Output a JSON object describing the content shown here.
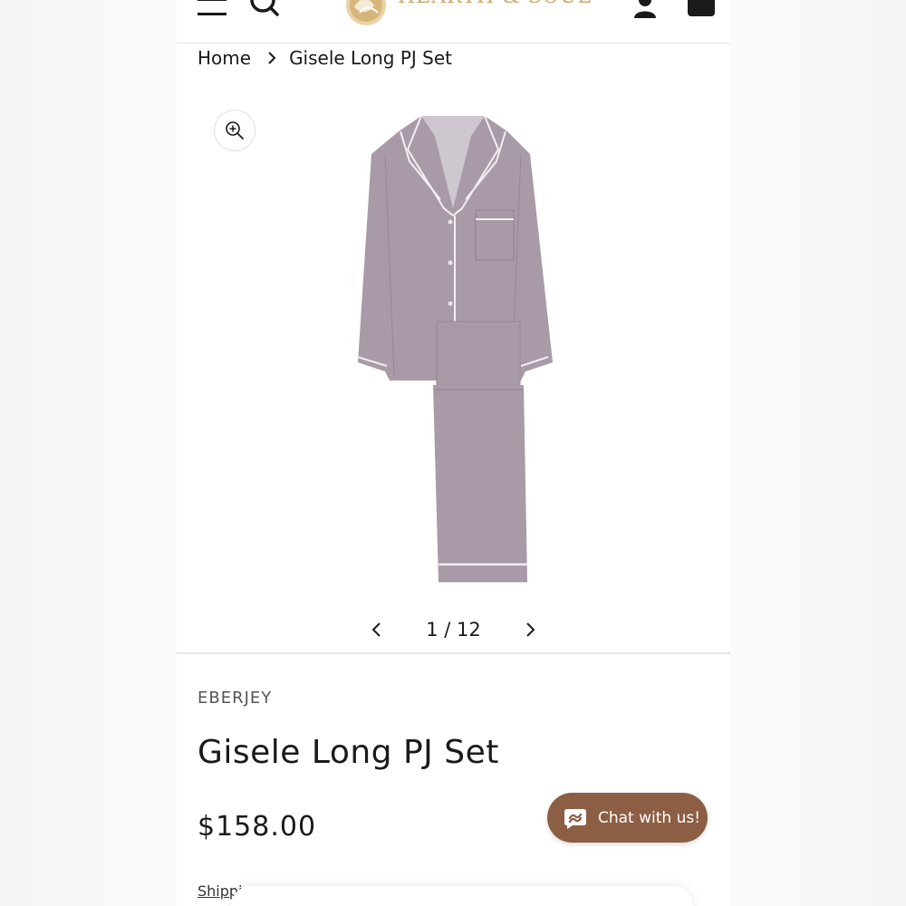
{
  "header": {
    "logo_text": "HEARTH & SOUL",
    "menu_icon": "hamburger-menu-icon",
    "search_icon": "search-icon",
    "account_icon": "account-icon",
    "cart_icon": "cart-icon",
    "logo_color": "#c9a86a"
  },
  "breadcrumb": {
    "home": "Home",
    "current": "Gisele Long PJ Set"
  },
  "gallery": {
    "zoom_icon": "zoom-in-icon",
    "counter": "1 / 12",
    "prev_icon": "chevron-left-icon",
    "next_icon": "chevron-right-icon",
    "product_color": "#a99aa8"
  },
  "product": {
    "vendor": "EBERJEY",
    "title": "Gisele Long PJ Set",
    "price": "$158.00",
    "shipping_text": "Shippi"
  },
  "chat": {
    "label": "Chat with us!",
    "color": "#8c5f44"
  }
}
